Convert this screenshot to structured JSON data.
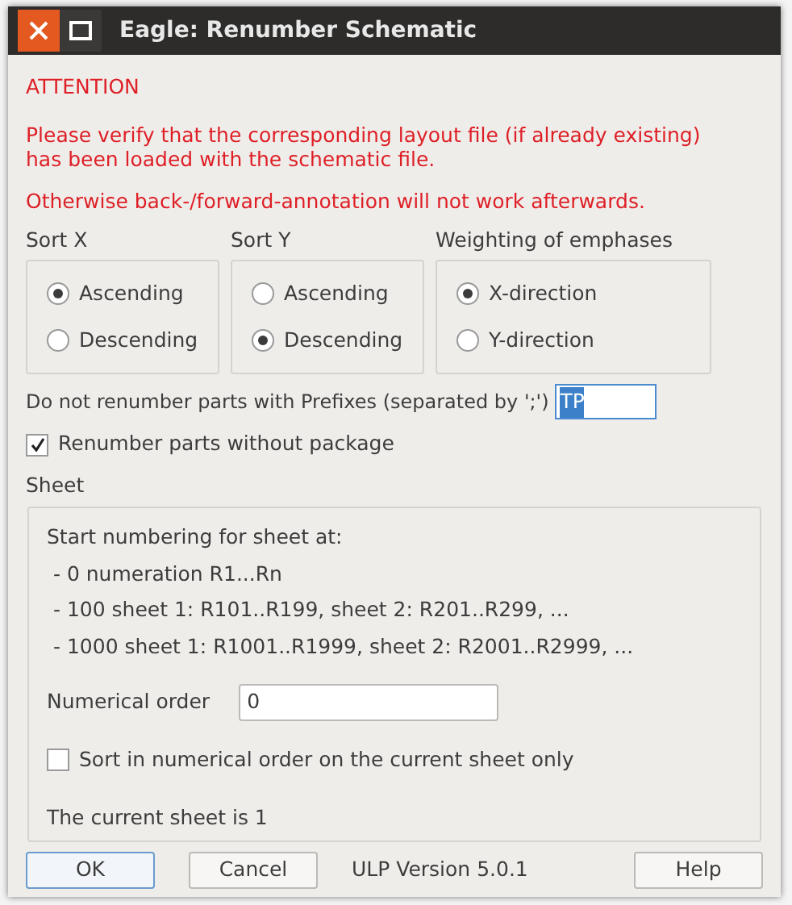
{
  "window": {
    "title": "Eagle: Renumber Schematic"
  },
  "warnings": [
    "ATTENTION",
    "Please verify that the corresponding layout file (if already existing) has been loaded with the schematic file.",
    "Otherwise back-/forward-annotation will not work afterwards."
  ],
  "groups": [
    {
      "title": "Sort X",
      "options": [
        {
          "label": "Ascending",
          "selected": true
        },
        {
          "label": "Descending",
          "selected": false
        }
      ]
    },
    {
      "title": "Sort Y",
      "options": [
        {
          "label": "Ascending",
          "selected": false
        },
        {
          "label": "Descending",
          "selected": true
        }
      ]
    },
    {
      "title": "Weighting of emphases",
      "options": [
        {
          "label": "X-direction",
          "selected": true
        },
        {
          "label": "Y-direction",
          "selected": false
        }
      ]
    }
  ],
  "prefix": {
    "label": "Do not renumber parts with Prefixes (separated by ';')",
    "value": "TP",
    "text_selected": true
  },
  "without_package": {
    "label": "Renumber parts without package",
    "checked": true
  },
  "sheet": {
    "title": "Sheet",
    "intro": "Start numbering for sheet at:",
    "lines": [
      " - 0 numeration R1...Rn",
      " - 100 sheet 1: R101..R199, sheet 2: R201..R299, ...",
      " - 1000 sheet 1: R1001..R1999, sheet 2: R2001..R2999, ..."
    ],
    "numerical_order": {
      "label": "Numerical order",
      "value": "0"
    },
    "current_only": {
      "label": "Sort in numerical order on the current sheet only",
      "checked": false
    },
    "current_sheet": "The current sheet is 1"
  },
  "buttons": [
    {
      "label": "OK",
      "default": true
    },
    {
      "label": "Cancel",
      "default": false
    }
  ],
  "version": "ULP Version 5.0.1",
  "help_button": {
    "label": "Help"
  }
}
